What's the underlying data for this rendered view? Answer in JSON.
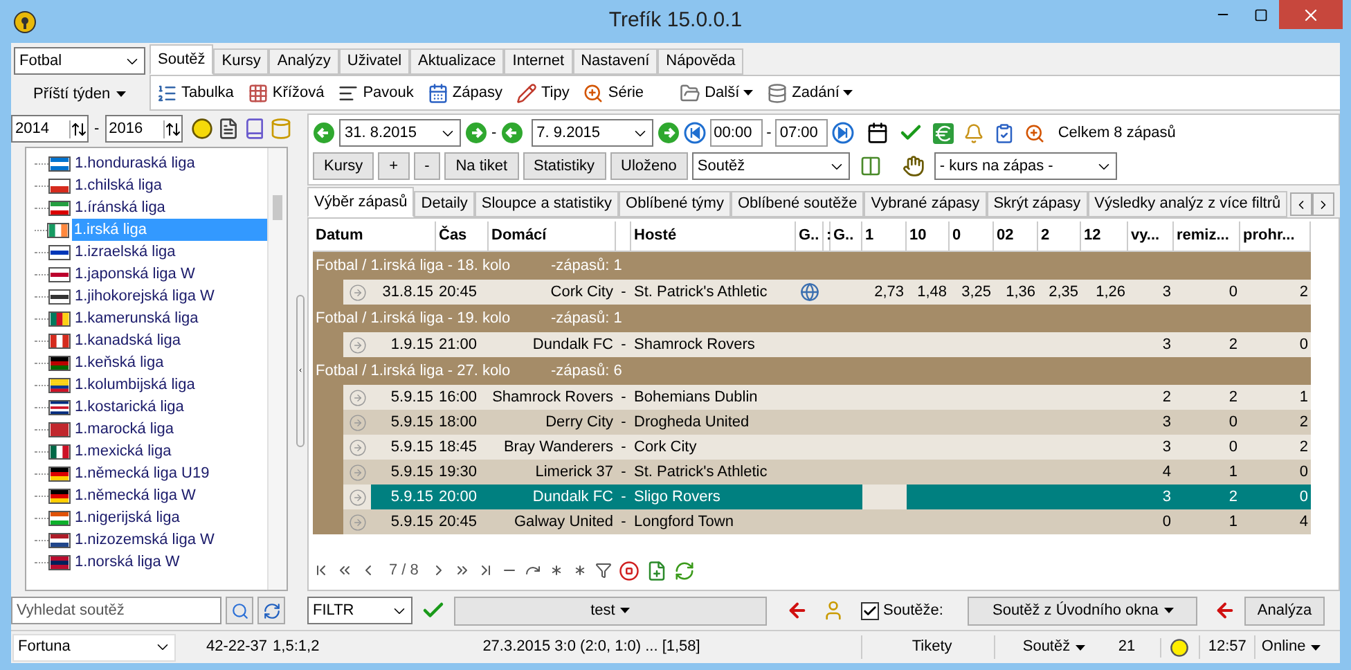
{
  "window": {
    "title": "Trefík 15.0.0.1"
  },
  "sport_select": {
    "value": "Fotbal"
  },
  "period_button": {
    "label": "Příští týden"
  },
  "menu_tabs": [
    {
      "label": "Soutěž",
      "selected": true
    },
    {
      "label": "Kursy",
      "selected": false
    },
    {
      "label": "Analýzy",
      "selected": false
    },
    {
      "label": "Uživatel",
      "selected": false
    },
    {
      "label": "Aktualizace",
      "selected": false
    },
    {
      "label": "Internet",
      "selected": false
    },
    {
      "label": "Nastavení",
      "selected": false
    },
    {
      "label": "Nápověda",
      "selected": false
    }
  ],
  "ribbon": [
    {
      "label": "Tabulka",
      "kind": "list"
    },
    {
      "label": "Křížová",
      "kind": "grid"
    },
    {
      "label": "Pavouk",
      "kind": "lines"
    },
    {
      "label": "Zápasy",
      "kind": "calendar"
    },
    {
      "label": "Tipy",
      "kind": "pencil"
    },
    {
      "label": "Série",
      "kind": "zoom"
    },
    {
      "label": "Další",
      "kind": "folder",
      "menu": true
    },
    {
      "label": "Zadání",
      "kind": "database",
      "menu": true
    }
  ],
  "years": {
    "from": "2014",
    "separator": "-",
    "to": "2016"
  },
  "leagues": [
    {
      "name": "1.honduraská liga",
      "selected": false
    },
    {
      "name": "1.chilská liga",
      "selected": false
    },
    {
      "name": "1.íránská liga",
      "selected": false
    },
    {
      "name": "1.irská liga",
      "selected": true
    },
    {
      "name": "1.izraelská liga",
      "selected": false
    },
    {
      "name": "1.japonská liga W",
      "selected": false
    },
    {
      "name": "1.jihokorejská liga W",
      "selected": false
    },
    {
      "name": "1.kamerunská liga",
      "selected": false
    },
    {
      "name": "1.kanadská liga",
      "selected": false
    },
    {
      "name": "1.keňská liga",
      "selected": false
    },
    {
      "name": "1.kolumbijská liga",
      "selected": false
    },
    {
      "name": "1.kostarická liga",
      "selected": false
    },
    {
      "name": "1.marocká liga",
      "selected": false
    },
    {
      "name": "1.mexická liga",
      "selected": false
    },
    {
      "name": "1.německá liga U19",
      "selected": false
    },
    {
      "name": "1.německá liga W",
      "selected": false
    },
    {
      "name": "1.nigerijská liga",
      "selected": false
    },
    {
      "name": "1.nizozemská liga W",
      "selected": false
    },
    {
      "name": "1.norská liga W",
      "selected": false
    }
  ],
  "search": {
    "placeholder": "Vyhledat soutěž"
  },
  "date_filter": {
    "from": "31.  8.2015",
    "date_separator": "-",
    "to": "7.  9.2015",
    "time_from": "00:00",
    "time_separator": "-",
    "time_to": "07:00",
    "total": "Celkem 8 zápasů"
  },
  "action_buttons": [
    "Kursy",
    "+",
    "-",
    "Na tiket",
    "Statistiky",
    "Uloženo"
  ],
  "competition_select": {
    "value": "Soutěž"
  },
  "odds_select": {
    "value": "- kurs na zápas -"
  },
  "view_tabs": [
    {
      "label": "Výběr zápasů",
      "selected": true
    },
    {
      "label": "Detaily",
      "selected": false
    },
    {
      "label": "Sloupce a statistiky",
      "selected": false
    },
    {
      "label": "Oblíbené týmy",
      "selected": false
    },
    {
      "label": "Oblíbené soutěže",
      "selected": false
    },
    {
      "label": "Vybrané zápasy",
      "selected": false
    },
    {
      "label": "Skrýt zápasy",
      "selected": false
    },
    {
      "label": "Výsledky analýz z více filtrů",
      "selected": false
    }
  ],
  "table": {
    "columns": [
      "Datum",
      "Čas",
      "Domácí",
      "Hosté",
      "G..",
      ":",
      "G..",
      "1",
      "10",
      "0",
      "02",
      "2",
      "12",
      "vy...",
      "remiz...",
      "prohr..."
    ],
    "groups": [
      {
        "title": "Fotbal / 1.irská liga - 18. kolo",
        "count": "-zápasů: 1",
        "matches": [
          {
            "date": "31.8.15",
            "time": "20:45",
            "home": "Cork City",
            "vs": "-",
            "away": "St. Patrick's Athletic",
            "info": true,
            "odds": [
              "2,73",
              "1,48",
              "3,25",
              "1,36",
              "2,35",
              "1,26"
            ],
            "won": "3",
            "draws": "0",
            "lost": "2",
            "selected": false
          }
        ]
      },
      {
        "title": "Fotbal / 1.irská liga - 19. kolo",
        "count": "-zápasů: 1",
        "matches": [
          {
            "date": "1.9.15",
            "time": "21:00",
            "home": "Dundalk FC",
            "vs": "-",
            "away": "Shamrock Rovers",
            "info": false,
            "won": "3",
            "draws": "2",
            "lost": "0",
            "selected": false
          }
        ]
      },
      {
        "title": "Fotbal / 1.irská liga - 27. kolo",
        "count": "-zápasů: 6",
        "matches": [
          {
            "date": "5.9.15",
            "time": "16:00",
            "home": "Shamrock Rovers",
            "vs": "-",
            "away": "Bohemians Dublin",
            "info": false,
            "won": "2",
            "draws": "2",
            "lost": "1",
            "selected": false
          },
          {
            "date": "5.9.15",
            "time": "18:00",
            "home": "Derry City",
            "vs": "-",
            "away": "Drogheda United",
            "info": false,
            "won": "3",
            "draws": "0",
            "lost": "2",
            "selected": false
          },
          {
            "date": "5.9.15",
            "time": "18:45",
            "home": "Bray Wanderers",
            "vs": "-",
            "away": "Cork City",
            "info": false,
            "won": "3",
            "draws": "0",
            "lost": "2",
            "selected": false
          },
          {
            "date": "5.9.15",
            "time": "19:30",
            "home": "Limerick 37",
            "vs": "-",
            "away": "St. Patrick's Athletic",
            "info": false,
            "won": "4",
            "draws": "1",
            "lost": "0",
            "selected": false
          },
          {
            "date": "5.9.15",
            "time": "20:00",
            "home": "Dundalk FC",
            "vs": "-",
            "away": "Sligo Rovers",
            "info": false,
            "won": "3",
            "draws": "2",
            "lost": "0",
            "selected": true
          },
          {
            "date": "5.9.15",
            "time": "20:45",
            "home": "Galway United",
            "vs": "-",
            "away": "Longford Town",
            "info": false,
            "won": "0",
            "draws": "1",
            "lost": "4",
            "selected": false
          }
        ]
      }
    ]
  },
  "pager": {
    "position": "7 / 8"
  },
  "filter_bar": {
    "filter_select": "FILTR",
    "preset": "test",
    "competitions_checkbox": {
      "label": "Soutěže:",
      "checked": true
    },
    "source": "Soutěž z Úvodního okna",
    "analyze": "Analýza"
  },
  "status_bar": {
    "bookmaker": "Fortuna",
    "record": "42-22-37",
    "ratio": "1,5:1,2",
    "last_result": "27.3.2015 3:0 (2:0, 1:0) ... [1,58]",
    "tickets": "Tikety",
    "competition": "Soutěž",
    "count": "21",
    "time": "12:57",
    "connection": "Online"
  }
}
